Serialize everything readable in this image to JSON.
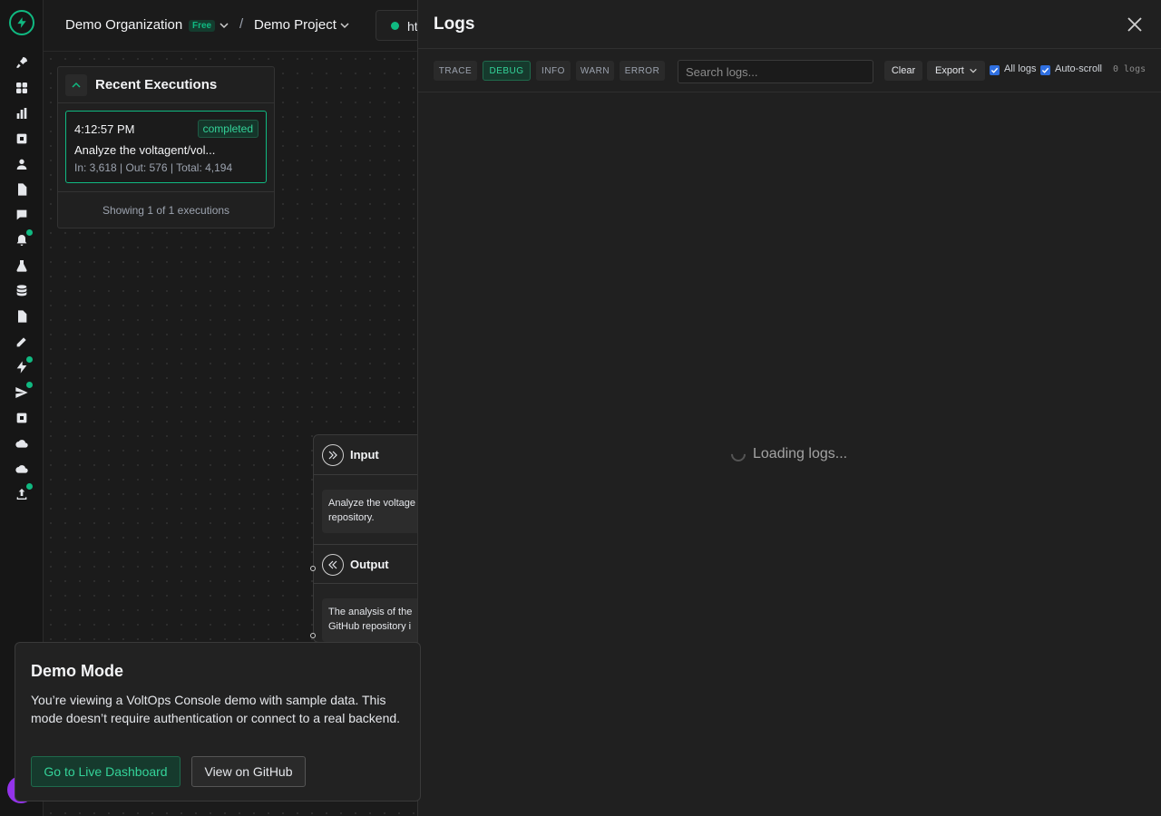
{
  "topbar": {
    "org_name": "Demo Organization",
    "plan_badge": "Free",
    "separator": "/",
    "project_name": "Demo Project",
    "env_label": "ht"
  },
  "rail": {
    "icons": [
      "logo-bolt-icon",
      "rocket-icon",
      "grid-icon",
      "bar-chart-icon",
      "cpu-icon",
      "user-icon",
      "file-icon",
      "chat-icon",
      "bell-icon",
      "flask-icon",
      "database-icon",
      "file-search-icon",
      "edit-icon",
      "bolt-icon",
      "send-icon",
      "cpu-icon",
      "cloud-icon",
      "cloud-icon",
      "upload-icon"
    ]
  },
  "recent": {
    "title": "Recent Executions",
    "execution": {
      "time": "4:12:57 PM",
      "status": "completed",
      "name": "Analyze the voltagent/vol...",
      "tokens": "In: 3,618 | Out: 576 | Total: 4,194"
    },
    "footer": "Showing 1 of 1 executions"
  },
  "node": {
    "input_label": "Input",
    "input_text": "Analyze the voltage\nrepository.",
    "output_label": "Output",
    "output_text": "The analysis of the\nGitHub repository i"
  },
  "logs": {
    "title": "Logs",
    "levels": [
      "TRACE",
      "DEBUG",
      "INFO",
      "WARN",
      "ERROR"
    ],
    "active_level": "DEBUG",
    "search_placeholder": "Search logs...",
    "clear_label": "Clear",
    "export_label": "Export",
    "all_logs_label": "All logs",
    "autoscroll_label": "Auto-scroll",
    "count": "0 logs",
    "loading_text": "Loading logs..."
  },
  "demo": {
    "title": "Demo Mode",
    "text": "You’re viewing a VoltOps Console demo with sample data. This mode doesn’t require authentication or connect to a real backend.",
    "live_button": "Go to Live Dashboard",
    "github_button": "View on GitHub"
  },
  "colors": {
    "accent": "#10b981",
    "background": "#1b1b1b",
    "panel": "#202020"
  }
}
